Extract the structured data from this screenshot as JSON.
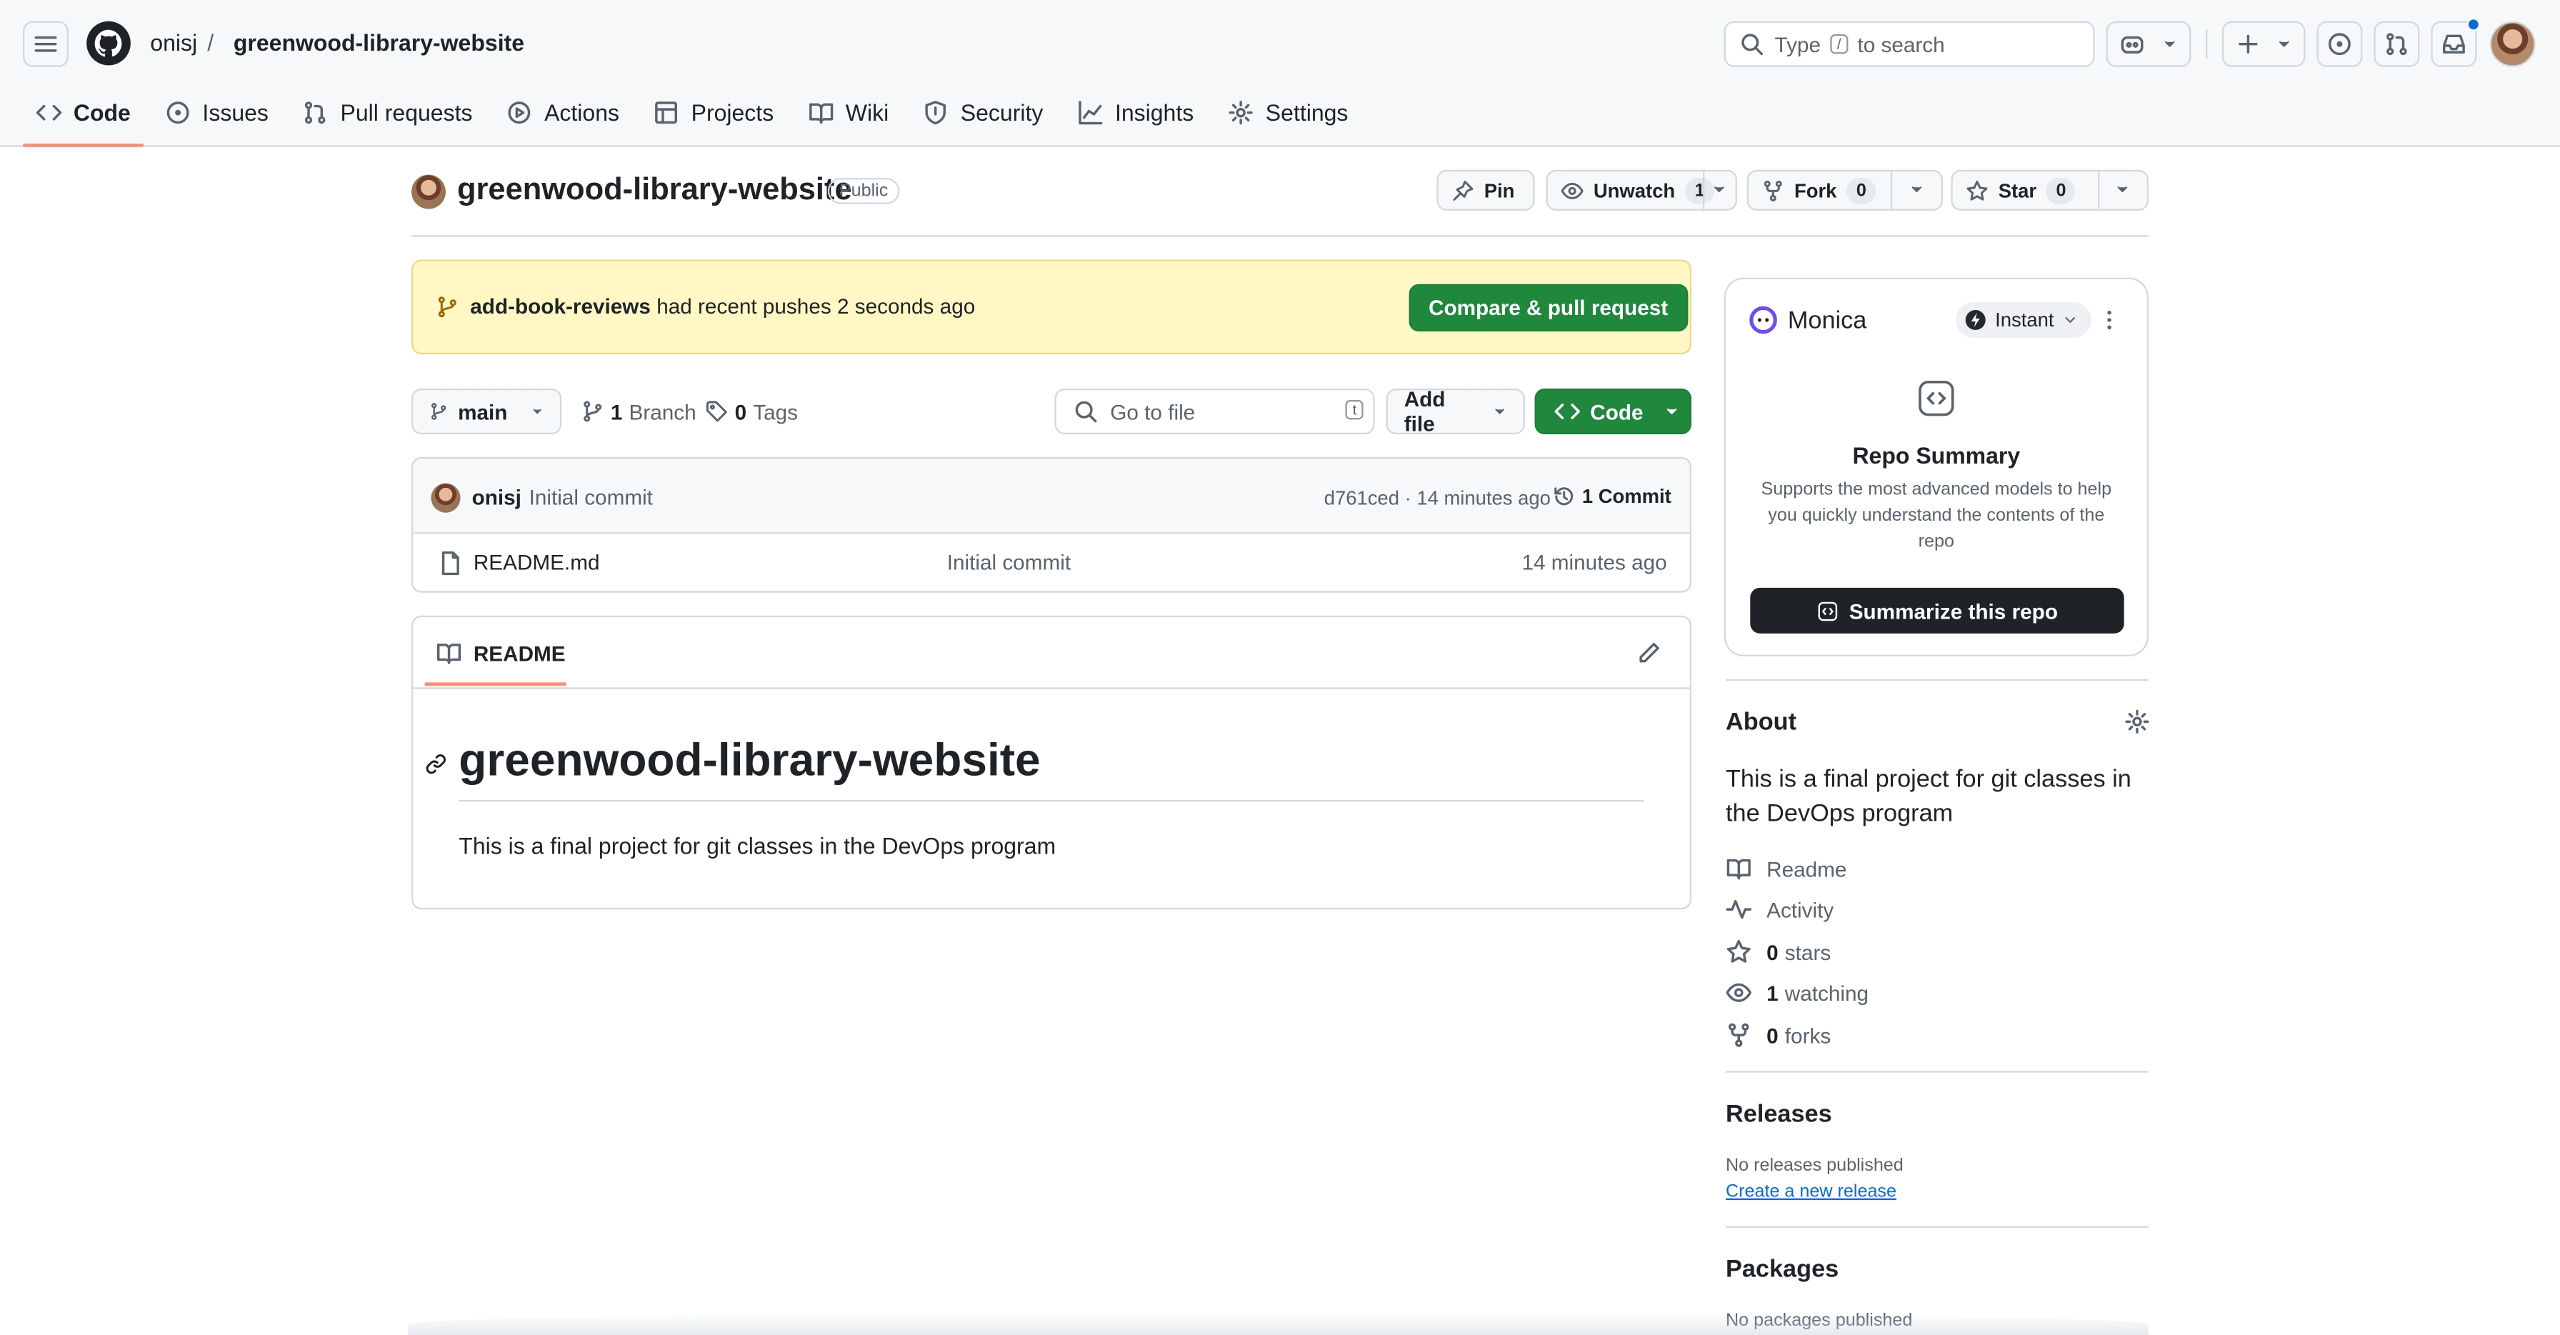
{
  "header": {
    "owner": "onisj",
    "separator": "/",
    "repo": "greenwood-library-website",
    "search_prefix": "Type",
    "search_key": "/",
    "search_suffix": "to search"
  },
  "tabs": [
    {
      "label": "Code",
      "icon": "code-icon"
    },
    {
      "label": "Issues",
      "icon": "issue-icon"
    },
    {
      "label": "Pull requests",
      "icon": "pull-request-icon"
    },
    {
      "label": "Actions",
      "icon": "play-icon"
    },
    {
      "label": "Projects",
      "icon": "table-icon"
    },
    {
      "label": "Wiki",
      "icon": "book-icon"
    },
    {
      "label": "Security",
      "icon": "shield-icon"
    },
    {
      "label": "Insights",
      "icon": "graph-icon"
    },
    {
      "label": "Settings",
      "icon": "gear-icon"
    }
  ],
  "repo_header": {
    "name": "greenwood-library-website",
    "visibility": "Public",
    "pin": "Pin",
    "unwatch": "Unwatch",
    "watch_count": "1",
    "fork": "Fork",
    "fork_count": "0",
    "star": "Star",
    "star_count": "0"
  },
  "banner": {
    "branch": "add-book-reviews",
    "text": "had recent pushes 2 seconds ago",
    "button": "Compare & pull request"
  },
  "file_nav": {
    "branch": "main",
    "branch_count": "1",
    "branch_label": "Branch",
    "tag_count": "0",
    "tag_label": "Tags",
    "go_to_file": "Go to file",
    "go_to_file_key": "t",
    "add_file": "Add file",
    "code": "Code"
  },
  "commit": {
    "author": "onisj",
    "message": "Initial commit",
    "hash_time": "d761ced · 14 minutes ago",
    "commits": "1 Commit"
  },
  "files": [
    {
      "name": "README.md",
      "message": "Initial commit",
      "time": "14 minutes ago"
    }
  ],
  "readme": {
    "tab": "README",
    "title": "greenwood-library-website",
    "body": "This is a final project for git classes in the DevOps program"
  },
  "monica": {
    "name": "Monica",
    "mode": "Instant",
    "title": "Repo Summary",
    "desc": "Supports the most advanced models to help you quickly understand the contents of the repo",
    "button": "Summarize this repo"
  },
  "about": {
    "title": "About",
    "desc": "This is a final project for git classes in the DevOps program",
    "readme": "Readme",
    "activity": "Activity",
    "stars_count": "0",
    "stars_label": "stars",
    "watching_count": "1",
    "watching_label": "watching",
    "forks_count": "0",
    "forks_label": "forks"
  },
  "releases": {
    "title": "Releases",
    "none": "No releases published",
    "create": "Create a new release"
  },
  "packages": {
    "title": "Packages",
    "none": "No packages published"
  },
  "colors": {
    "accent_green": "#1f883d",
    "tab_underline": "#fd8c73",
    "banner_bg": "#fff8c5",
    "link": "#0969da"
  }
}
